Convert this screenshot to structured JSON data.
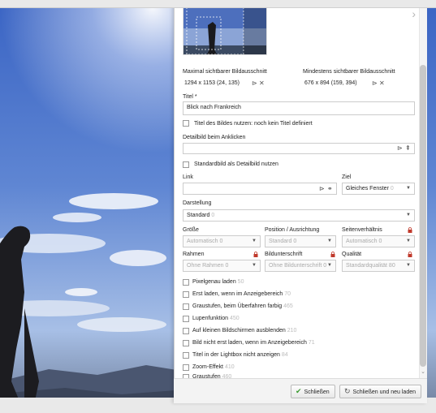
{
  "crop": {
    "max_label": "Maximal sichtbarer Bildausschnitt",
    "max_value": "1294 x 1153 (24, 135)",
    "min_label": "Mindestens sichtbarer Bildausschnitt",
    "min_value": "676 x 894 (159, 394)"
  },
  "title": {
    "label": "Titel *",
    "value": "Blick nach Frankreich"
  },
  "use_title": {
    "label": "Titel des Bildes nutzen: noch kein Titel definiert",
    "checked": false
  },
  "detail": {
    "label": "Detailbild beim Anklicken",
    "value": ""
  },
  "default_detail": {
    "label": "Standardbild als Detailbild nutzen",
    "checked": false
  },
  "link": {
    "label": "Link",
    "value": ""
  },
  "target": {
    "label": "Ziel",
    "value": "Gleiches Fenster",
    "hint": "0"
  },
  "display": {
    "label": "Darstellung",
    "value": "Standard",
    "hint": "0"
  },
  "size": {
    "label": "Größe",
    "value": "Automatisch 0"
  },
  "position": {
    "label": "Position / Ausrichtung",
    "value": "Standard 0"
  },
  "ratio": {
    "label": "Seitenverhältnis",
    "value": "Automatisch 0"
  },
  "frame": {
    "label": "Rahmen",
    "value": "Ohne Rahmen 0"
  },
  "caption": {
    "label": "Bildunterschrift",
    "value": "Ohne Bildunterschrift 0"
  },
  "quality": {
    "label": "Qualität",
    "value": "Standardqualität 80"
  },
  "options": [
    {
      "label": "Pixelgenau laden",
      "num": "50"
    },
    {
      "label": "Erst laden, wenn im Anzeigebereich",
      "num": "70"
    },
    {
      "label": "Graustufen, beim Überfahren farbig",
      "num": "465"
    },
    {
      "label": "Lupenfunktion",
      "num": "450"
    },
    {
      "label": "Auf kleinen Bildschirmen ausblenden",
      "num": "210"
    },
    {
      "label": "Bild nicht erst laden, wenn im Anzeigebereich",
      "num": "71"
    },
    {
      "label": "Titel in der Lightbox nicht anzeigen",
      "num": "84"
    },
    {
      "label": "Zoom-Effekt",
      "num": "410"
    },
    {
      "label": "Graustufen",
      "num": "460"
    }
  ],
  "footer": {
    "close_label": "Schließen",
    "close_reload_label": "Schließen und neu laden"
  },
  "colors": {
    "accent_green": "#3a9a2f",
    "lock_red": "#c0392b"
  }
}
